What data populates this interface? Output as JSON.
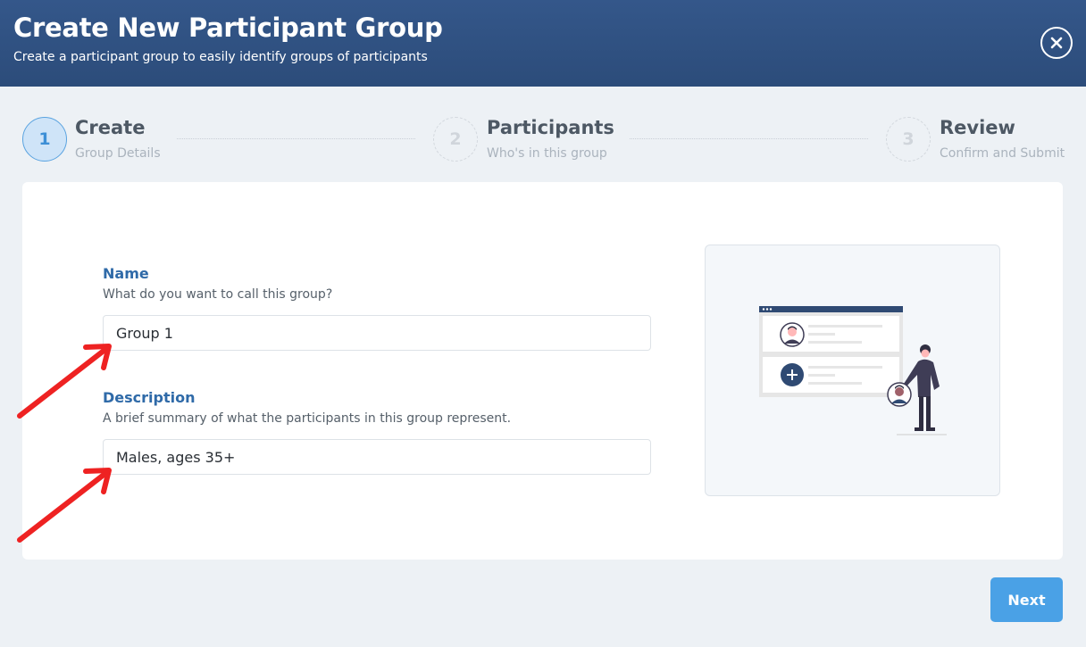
{
  "header": {
    "title": "Create New Participant Group",
    "subtitle": "Create a participant group to easily identify groups of participants"
  },
  "steps": [
    {
      "number": "1",
      "title": "Create",
      "subtitle": "Group Details",
      "active": true
    },
    {
      "number": "2",
      "title": "Participants",
      "subtitle": "Who's in this group",
      "active": false
    },
    {
      "number": "3",
      "title": "Review",
      "subtitle": "Confirm and Submit",
      "active": false
    }
  ],
  "form": {
    "name": {
      "label": "Name",
      "help": "What do you want to call this group?",
      "value": "Group 1"
    },
    "description": {
      "label": "Description",
      "help": "A brief summary of what the participants in this group represent.",
      "value": "Males, ages 35+"
    }
  },
  "actions": {
    "next_label": "Next"
  },
  "icons": {
    "close": "close-icon",
    "illustration": "participants-illustration",
    "annotation": "red-arrow-icon"
  },
  "colors": {
    "header": "#2f5080",
    "accent": "#4aa1e6",
    "label": "#2f6aa8",
    "annotation": "#ee2222"
  }
}
